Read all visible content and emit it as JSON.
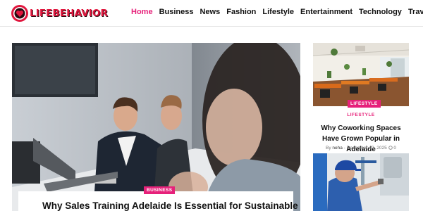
{
  "brand": {
    "name": "LIFEBEHAVIOR",
    "accent": "#e6217a",
    "logo_red": "#e0163d"
  },
  "nav": {
    "items": [
      {
        "label": "Home",
        "active": true
      },
      {
        "label": "Business",
        "active": false
      },
      {
        "label": "News",
        "active": false
      },
      {
        "label": "Fashion",
        "active": false
      },
      {
        "label": "Lifestyle",
        "active": false
      },
      {
        "label": "Entertainment",
        "active": false
      },
      {
        "label": "Technology",
        "active": false
      },
      {
        "label": "Travel",
        "active": false
      }
    ]
  },
  "featured": {
    "category": "BUSINESS",
    "title": "Why Sales Training Adelaide Is Essential for Sustainable",
    "image_icon": "office-meeting-photo"
  },
  "side_posts": [
    {
      "badge": "LIFESTYLE",
      "category": "LIFESTYLE",
      "title": "Why Coworking Spaces Have Grown Popular in Adelaide",
      "author_prefix": "By",
      "author": "neha",
      "separator": "-",
      "date": "December 12, 2025",
      "comments": "0",
      "image_icon": "coworking-space-photo"
    },
    {
      "image_icon": "plumber-photo"
    }
  ]
}
